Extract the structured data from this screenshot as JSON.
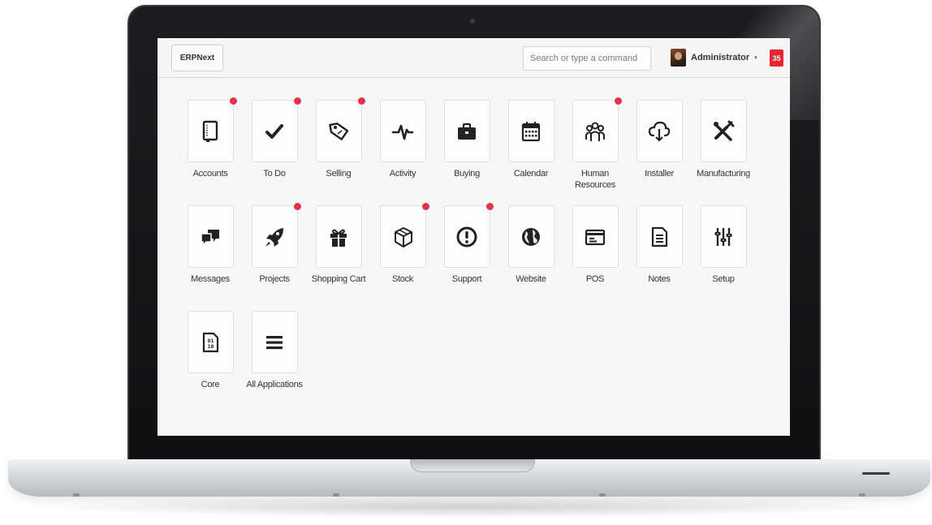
{
  "navbar": {
    "brand": "ERPNext",
    "search_placeholder": "Search or type a command",
    "user_name": "Administrator",
    "user_caret": "▾",
    "notification_count": "35"
  },
  "apps": [
    {
      "label": "Accounts",
      "icon": "book-icon",
      "notification": true
    },
    {
      "label": "To Do",
      "icon": "checkmark-icon",
      "notification": true
    },
    {
      "label": "Selling",
      "icon": "tag-icon",
      "notification": true
    },
    {
      "label": "Activity",
      "icon": "pulse-icon",
      "notification": false
    },
    {
      "label": "Buying",
      "icon": "briefcase-icon",
      "notification": false
    },
    {
      "label": "Calendar",
      "icon": "calendar-icon",
      "notification": false
    },
    {
      "label": "Human Resources",
      "icon": "people-icon",
      "notification": true
    },
    {
      "label": "Installer",
      "icon": "cloud-download-icon",
      "notification": false
    },
    {
      "label": "Manufacturing",
      "icon": "tools-icon",
      "notification": false
    },
    {
      "label": "Messages",
      "icon": "chat-bubbles-icon",
      "notification": false
    },
    {
      "label": "Projects",
      "icon": "rocket-icon",
      "notification": true
    },
    {
      "label": "Shopping Cart",
      "icon": "gift-icon",
      "notification": false
    },
    {
      "label": "Stock",
      "icon": "box-icon",
      "notification": true
    },
    {
      "label": "Support",
      "icon": "exclamation-circle-icon",
      "notification": true
    },
    {
      "label": "Website",
      "icon": "globe-icon",
      "notification": false
    },
    {
      "label": "POS",
      "icon": "card-terminal-icon",
      "notification": false
    },
    {
      "label": "Notes",
      "icon": "document-icon",
      "notification": false
    },
    {
      "label": "Setup",
      "icon": "sliders-icon",
      "notification": false
    },
    {
      "label": "Core",
      "icon": "binary-file-icon",
      "notification": false
    },
    {
      "label": "All Applications",
      "icon": "list-icon",
      "notification": false
    }
  ],
  "colors": {
    "notification_dot": "#e3334b",
    "badge": "#e3262f",
    "icon": "#222222"
  }
}
